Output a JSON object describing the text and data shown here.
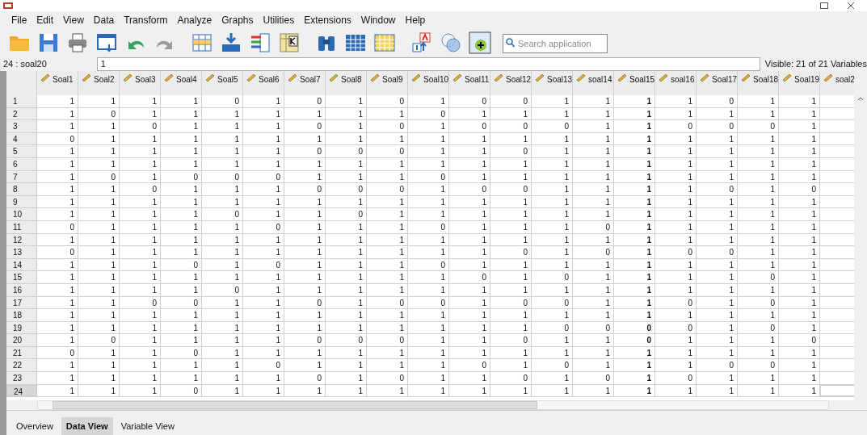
{
  "menu": [
    "File",
    "Edit",
    "View",
    "Data",
    "Transform",
    "Analyze",
    "Graphs",
    "Utilities",
    "Extensions",
    "Window",
    "Help"
  ],
  "search": {
    "placeholder": "Search application"
  },
  "cell_editor": {
    "reference": "24 : soal20",
    "value": "1",
    "visible": "Visible: 21 of 21 Variables"
  },
  "table": {
    "columns": [
      {
        "name": "Soal1",
        "bold": false
      },
      {
        "name": "Soal2",
        "bold": false
      },
      {
        "name": "Soal3",
        "bold": false
      },
      {
        "name": "Soal4",
        "bold": false
      },
      {
        "name": "Soal5",
        "bold": false
      },
      {
        "name": "Soal6",
        "bold": false
      },
      {
        "name": "Soal7",
        "bold": false
      },
      {
        "name": "Soal8",
        "bold": false
      },
      {
        "name": "Soal9",
        "bold": false
      },
      {
        "name": "Soal10",
        "bold": false
      },
      {
        "name": "Soal11",
        "bold": false
      },
      {
        "name": "Soal12",
        "bold": false
      },
      {
        "name": "Soal13",
        "bold": false
      },
      {
        "name": "soal14",
        "bold": false
      },
      {
        "name": "Soal15",
        "bold": true
      },
      {
        "name": "soal16",
        "bold": false
      },
      {
        "name": "Soal17",
        "bold": false
      },
      {
        "name": "Soal18",
        "bold": false
      },
      {
        "name": "Soal19",
        "bold": false
      },
      {
        "name": "soal2",
        "bold": false
      }
    ],
    "rows": [
      {
        "number": "1",
        "selected": false,
        "cells": [
          "1",
          "1",
          "1",
          "1",
          "0",
          "1",
          "0",
          "1",
          "0",
          "1",
          "0",
          "0",
          "1",
          "1",
          "1",
          "1",
          "0",
          "1",
          "1"
        ]
      },
      {
        "number": "2",
        "selected": false,
        "cells": [
          "1",
          "0",
          "1",
          "1",
          "1",
          "1",
          "1",
          "1",
          "1",
          "0",
          "1",
          "1",
          "1",
          "1",
          "1",
          "1",
          "1",
          "1",
          "1"
        ]
      },
      {
        "number": "3",
        "selected": false,
        "cells": [
          "1",
          "1",
          "0",
          "1",
          "1",
          "1",
          "0",
          "1",
          "0",
          "1",
          "0",
          "0",
          "0",
          "1",
          "1",
          "0",
          "0",
          "0",
          "1"
        ]
      },
      {
        "number": "4",
        "selected": false,
        "cells": [
          "0",
          "1",
          "1",
          "1",
          "1",
          "1",
          "1",
          "1",
          "1",
          "1",
          "1",
          "1",
          "1",
          "1",
          "1",
          "1",
          "1",
          "1",
          "1"
        ]
      },
      {
        "number": "5",
        "selected": false,
        "cells": [
          "1",
          "1",
          "1",
          "1",
          "1",
          "1",
          "0",
          "0",
          "0",
          "1",
          "1",
          "0",
          "1",
          "1",
          "1",
          "1",
          "1",
          "1",
          "1"
        ]
      },
      {
        "number": "6",
        "selected": false,
        "cells": [
          "1",
          "1",
          "1",
          "1",
          "1",
          "1",
          "1",
          "1",
          "1",
          "1",
          "1",
          "1",
          "1",
          "1",
          "1",
          "1",
          "1",
          "1",
          "1"
        ]
      },
      {
        "number": "7",
        "selected": false,
        "cells": [
          "1",
          "0",
          "1",
          "0",
          "0",
          "0",
          "1",
          "1",
          "1",
          "0",
          "1",
          "1",
          "1",
          "1",
          "1",
          "1",
          "1",
          "1",
          "1"
        ]
      },
      {
        "number": "8",
        "selected": false,
        "cells": [
          "1",
          "1",
          "0",
          "1",
          "1",
          "1",
          "0",
          "0",
          "0",
          "1",
          "0",
          "0",
          "1",
          "1",
          "1",
          "1",
          "0",
          "1",
          "0"
        ]
      },
      {
        "number": "9",
        "selected": false,
        "cells": [
          "1",
          "1",
          "1",
          "1",
          "1",
          "1",
          "1",
          "1",
          "1",
          "1",
          "1",
          "1",
          "1",
          "1",
          "1",
          "1",
          "1",
          "1",
          "1"
        ]
      },
      {
        "number": "10",
        "selected": false,
        "cells": [
          "1",
          "1",
          "1",
          "1",
          "0",
          "1",
          "1",
          "0",
          "1",
          "1",
          "1",
          "1",
          "1",
          "1",
          "1",
          "1",
          "1",
          "1",
          "1"
        ]
      },
      {
        "number": "11",
        "selected": false,
        "cells": [
          "0",
          "1",
          "1",
          "1",
          "1",
          "0",
          "1",
          "1",
          "1",
          "0",
          "1",
          "1",
          "1",
          "0",
          "1",
          "1",
          "1",
          "1",
          "1"
        ]
      },
      {
        "number": "12",
        "selected": false,
        "cells": [
          "1",
          "1",
          "1",
          "1",
          "1",
          "1",
          "1",
          "1",
          "1",
          "1",
          "1",
          "1",
          "1",
          "1",
          "1",
          "1",
          "1",
          "1",
          "1"
        ]
      },
      {
        "number": "13",
        "selected": false,
        "cells": [
          "0",
          "1",
          "1",
          "1",
          "1",
          "1",
          "1",
          "1",
          "1",
          "1",
          "1",
          "0",
          "1",
          "0",
          "1",
          "0",
          "0",
          "1",
          "1"
        ]
      },
      {
        "number": "14",
        "selected": false,
        "cells": [
          "1",
          "1",
          "1",
          "0",
          "1",
          "0",
          "1",
          "1",
          "1",
          "0",
          "1",
          "1",
          "1",
          "1",
          "1",
          "1",
          "1",
          "1",
          "1"
        ]
      },
      {
        "number": "15",
        "selected": false,
        "cells": [
          "1",
          "1",
          "1",
          "1",
          "1",
          "1",
          "1",
          "1",
          "1",
          "1",
          "0",
          "1",
          "0",
          "1",
          "1",
          "1",
          "1",
          "0",
          "1"
        ]
      },
      {
        "number": "16",
        "selected": false,
        "cells": [
          "1",
          "1",
          "1",
          "1",
          "0",
          "1",
          "1",
          "1",
          "1",
          "1",
          "1",
          "1",
          "1",
          "1",
          "1",
          "1",
          "1",
          "1",
          "1"
        ]
      },
      {
        "number": "17",
        "selected": false,
        "cells": [
          "1",
          "1",
          "0",
          "0",
          "1",
          "1",
          "0",
          "1",
          "0",
          "0",
          "1",
          "0",
          "0",
          "1",
          "1",
          "0",
          "1",
          "0",
          "1"
        ]
      },
      {
        "number": "18",
        "selected": false,
        "cells": [
          "1",
          "1",
          "1",
          "1",
          "1",
          "1",
          "1",
          "1",
          "1",
          "1",
          "1",
          "1",
          "1",
          "1",
          "1",
          "1",
          "1",
          "1",
          "1"
        ]
      },
      {
        "number": "19",
        "selected": false,
        "cells": [
          "1",
          "1",
          "1",
          "1",
          "1",
          "1",
          "1",
          "1",
          "1",
          "1",
          "1",
          "1",
          "0",
          "0",
          "0",
          "0",
          "1",
          "0",
          "1"
        ]
      },
      {
        "number": "20",
        "selected": false,
        "cells": [
          "1",
          "0",
          "1",
          "1",
          "1",
          "1",
          "0",
          "0",
          "0",
          "1",
          "1",
          "0",
          "1",
          "1",
          "0",
          "1",
          "1",
          "1",
          "0"
        ]
      },
      {
        "number": "21",
        "selected": false,
        "cells": [
          "0",
          "1",
          "1",
          "0",
          "1",
          "1",
          "1",
          "1",
          "1",
          "1",
          "1",
          "1",
          "1",
          "1",
          "1",
          "1",
          "1",
          "1",
          "1"
        ]
      },
      {
        "number": "22",
        "selected": false,
        "cells": [
          "1",
          "1",
          "1",
          "1",
          "1",
          "0",
          "1",
          "1",
          "1",
          "1",
          "0",
          "1",
          "0",
          "1",
          "1",
          "1",
          "0",
          "0",
          "1"
        ]
      },
      {
        "number": "23",
        "selected": false,
        "cells": [
          "1",
          "1",
          "1",
          "1",
          "1",
          "1",
          "0",
          "1",
          "0",
          "1",
          "1",
          "0",
          "1",
          "0",
          "1",
          "0",
          "1",
          "1",
          "1"
        ]
      },
      {
        "number": "24",
        "selected": true,
        "cells": [
          "1",
          "1",
          "1",
          "0",
          "1",
          "1",
          "1",
          "1",
          "1",
          "1",
          "1",
          "1",
          "1",
          "1",
          "1",
          "1",
          "1",
          "1",
          "1"
        ]
      }
    ]
  },
  "tabs": [
    {
      "label": "Overview",
      "selected": false
    },
    {
      "label": "Data View",
      "selected": true
    },
    {
      "label": "Variable View",
      "selected": false
    }
  ]
}
